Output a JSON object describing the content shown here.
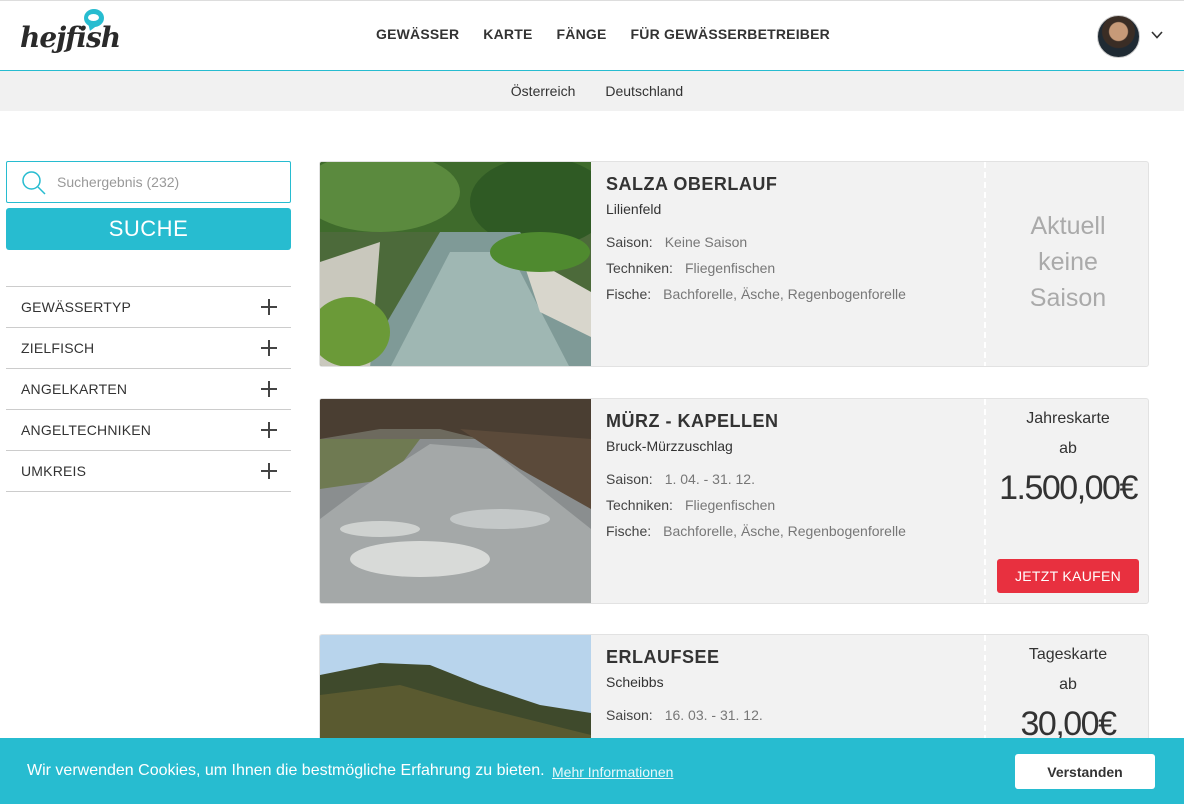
{
  "header": {
    "logo": "hejfish",
    "nav": [
      "GEWÄSSER",
      "KARTE",
      "FÄNGE",
      "FÜR GEWÄSSERBETREIBER"
    ]
  },
  "subnav": [
    "Österreich",
    "Deutschland"
  ],
  "sidebar": {
    "search_placeholder": "Suchergebnis (232)",
    "search_button": "SUCHE",
    "filters": [
      "GEWÄSSERTYP",
      "ZIELFISCH",
      "ANGELKARTEN",
      "ANGELTECHNIKEN",
      "UMKREIS"
    ]
  },
  "labels": {
    "saison": "Saison:",
    "techniken": "Techniken:",
    "fische": "Fische:",
    "ab": "ab",
    "buy": "JETZT KAUFEN"
  },
  "listings": [
    {
      "title": "SALZA OBERLAUF",
      "place": "Lilienfeld",
      "saison": "Keine Saison",
      "techniken": "Fliegenfischen",
      "fische": "Bachforelle, Äsche, Regenbogenforelle",
      "no_season_text": "Aktuell keine Saison"
    },
    {
      "title": "MÜRZ - KAPELLEN",
      "place": "Bruck-Mürzzuschlag",
      "saison": "1. 04. - 31. 12.",
      "techniken": "Fliegenfischen",
      "fische": "Bachforelle, Äsche, Regenbogenforelle",
      "ticket": "Jahreskarte",
      "amount": "1.500,00€"
    },
    {
      "title": "ERLAUFSEE",
      "place": "Scheibbs",
      "saison": "16. 03. - 31. 12.",
      "ticket": "Tageskarte",
      "amount": "30,00€"
    }
  ],
  "cookie": {
    "message": "Wir verwenden Cookies, um Ihnen die bestmögliche Erfahrung zu bieten.",
    "more": "Mehr Informationen",
    "accept": "Verstanden"
  },
  "colors": {
    "accent": "#27bcd0",
    "buy": "#e8303f",
    "card_bg": "#f2f2f2"
  }
}
